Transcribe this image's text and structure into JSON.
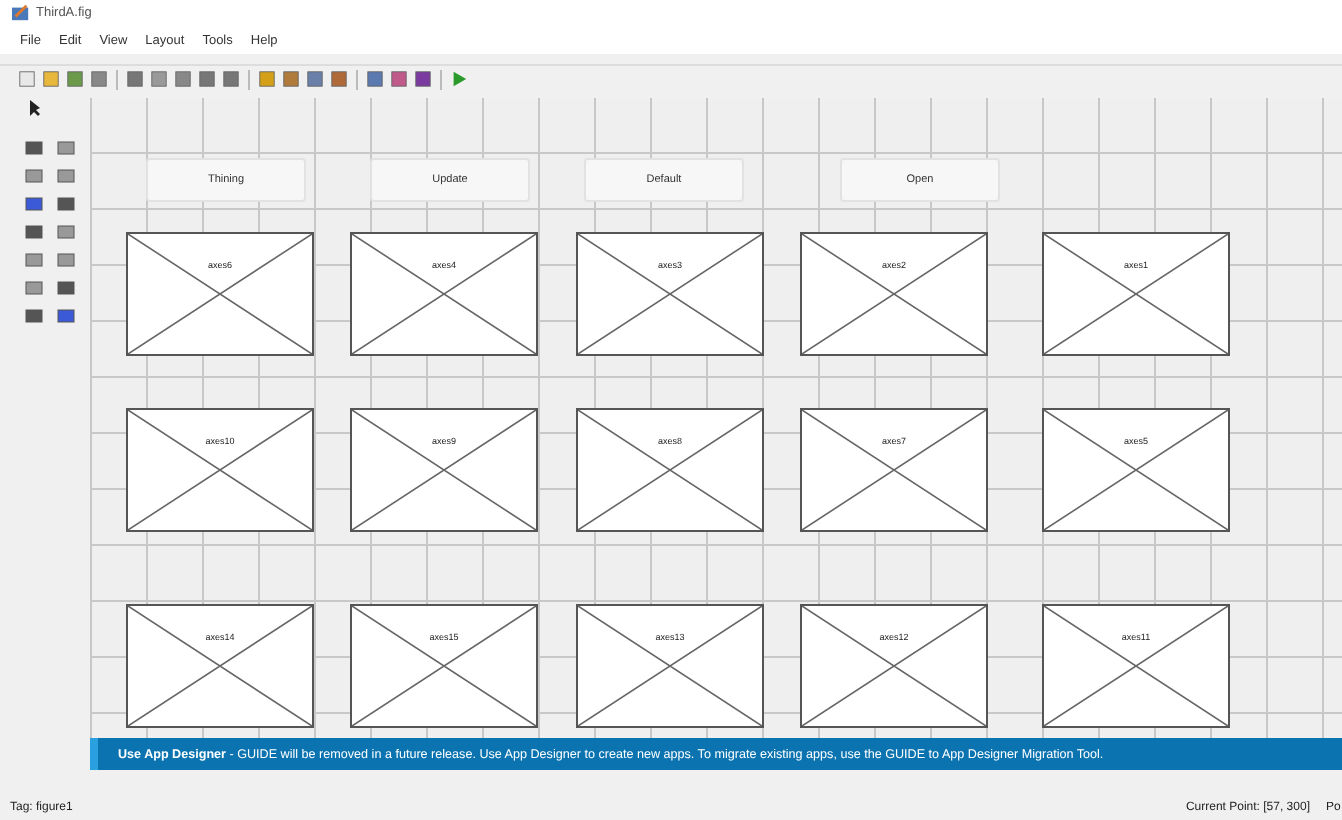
{
  "window": {
    "title": "ThirdA.fig"
  },
  "menu": [
    "File",
    "Edit",
    "View",
    "Layout",
    "Tools",
    "Help"
  ],
  "buttons": [
    {
      "label": "Thining"
    },
    {
      "label": "Update"
    },
    {
      "label": "Default"
    },
    {
      "label": "Open"
    }
  ],
  "axes_rows": [
    [
      "axes6",
      "axes4",
      "axes3",
      "axes2",
      "axes1"
    ],
    [
      "axes10",
      "axes9",
      "axes8",
      "axes7",
      "axes5"
    ],
    [
      "axes14",
      "axes15",
      "axes13",
      "axes12",
      "axes11"
    ]
  ],
  "banner": "**Use App Designer** - GUIDE will be removed in a future release. Use App Designer to create new apps. To migrate existing apps, use the GUIDE to App Designer Migration Tool.",
  "status_bar": {
    "tag": "Tag: figure1",
    "current_point": "Current Point: [57, 300]",
    "position": "Po"
  }
}
